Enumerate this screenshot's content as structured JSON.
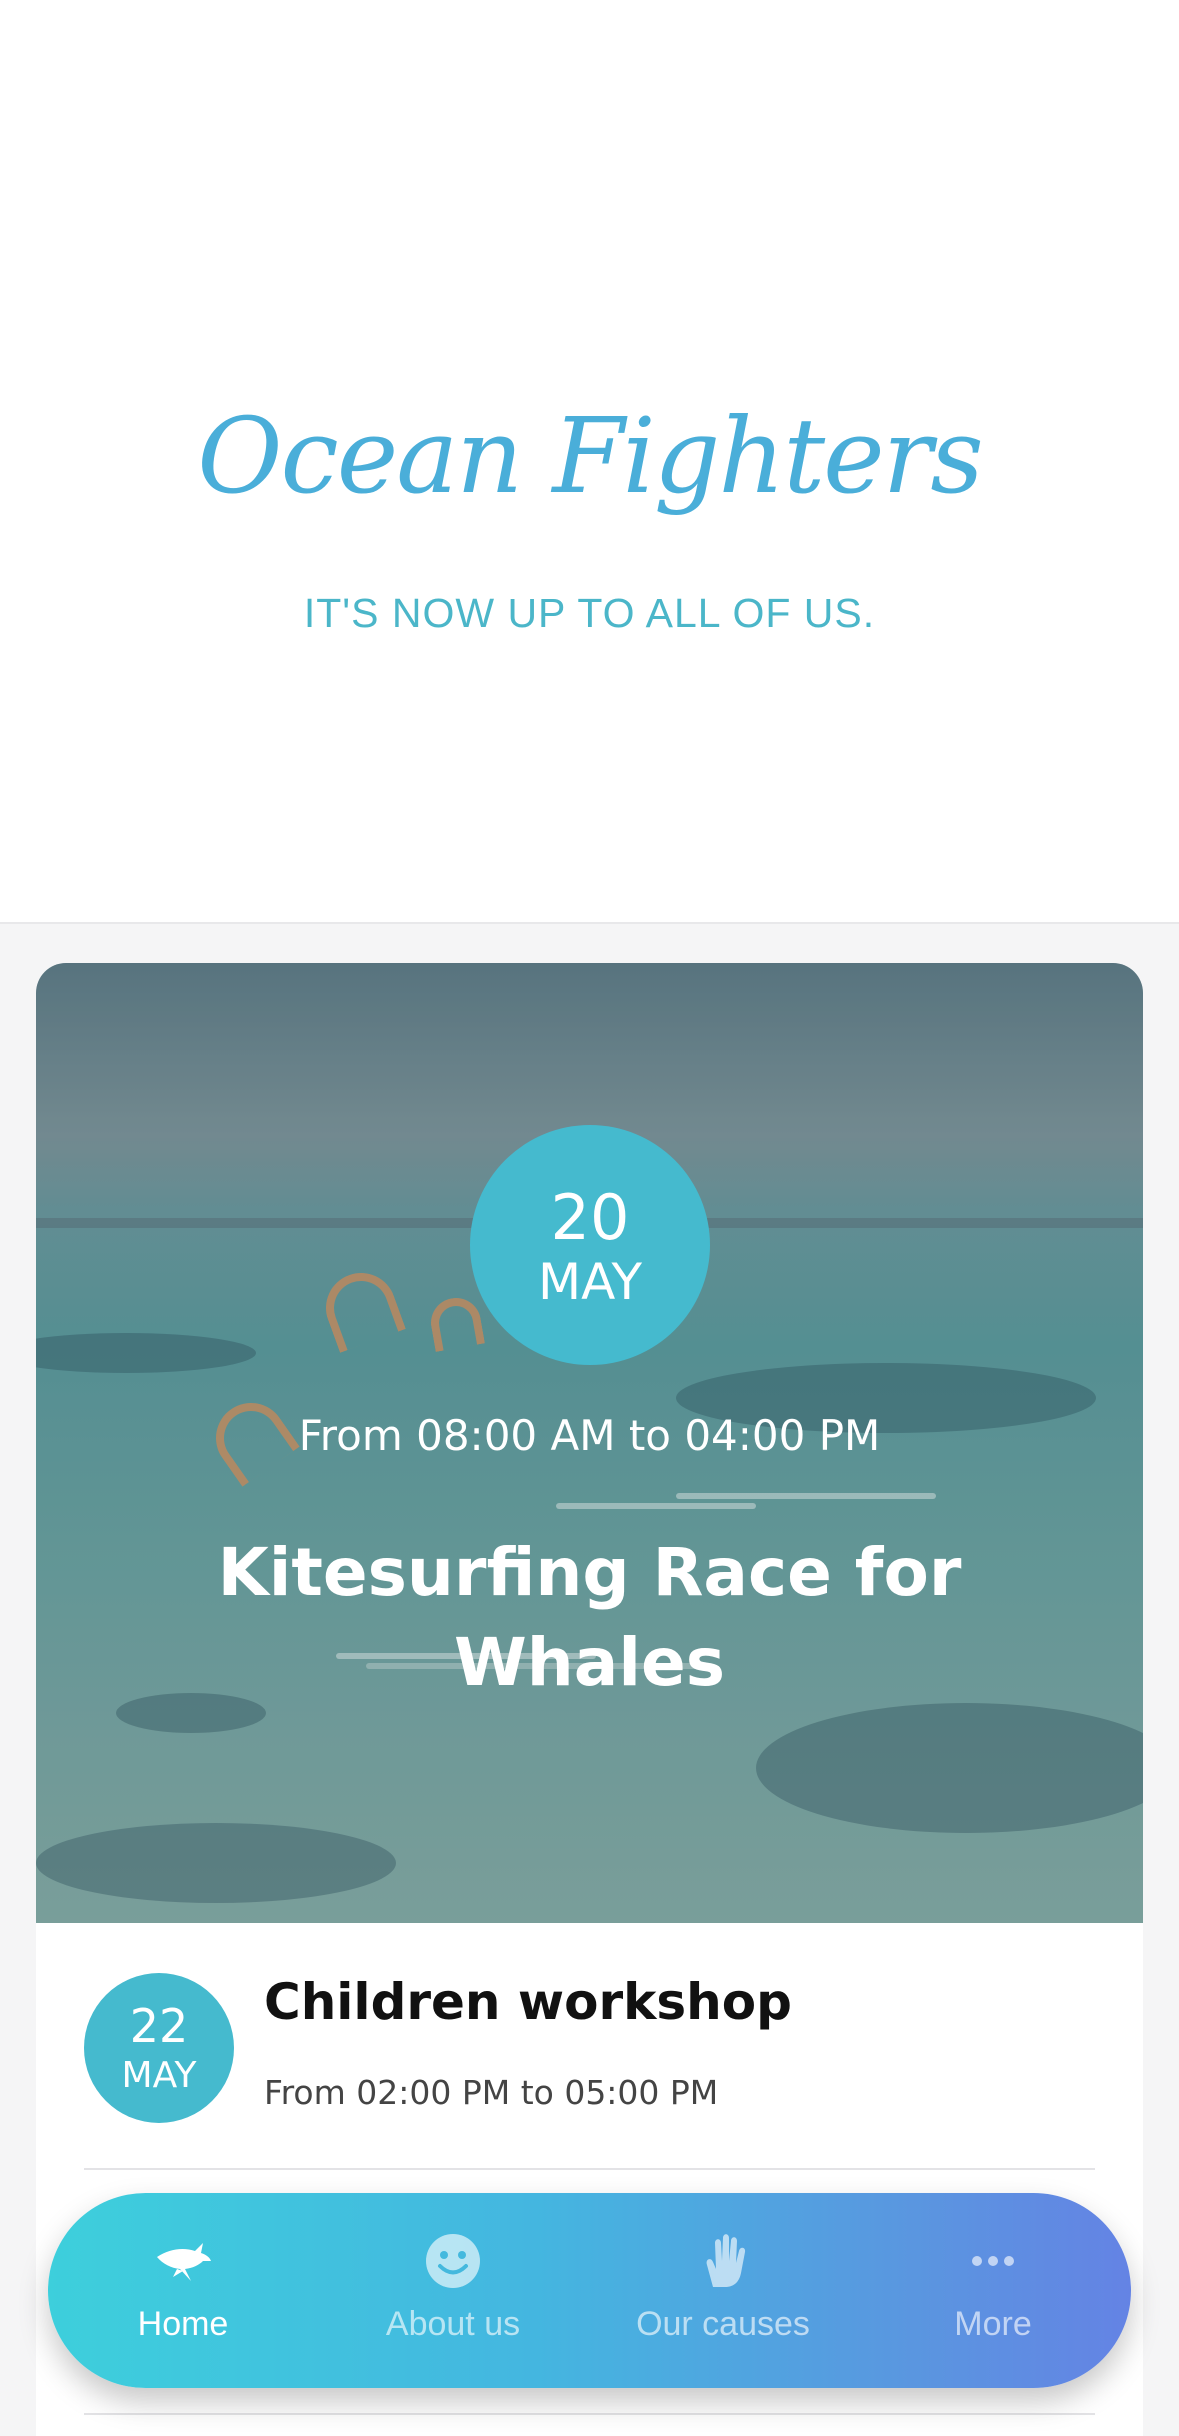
{
  "header": {
    "title": "Ocean Fighters",
    "tagline": "IT'S NOW UP TO ALL OF US."
  },
  "featured_event": {
    "day": "20",
    "month": "MAY",
    "time": "From 08:00 AM to 04:00 PM",
    "title": "Kitesurfing Race for Whales"
  },
  "events": [
    {
      "day": "22",
      "month": "MAY",
      "title": "Children workshop",
      "time": "From 02:00 PM to 05:00 PM"
    }
  ],
  "tabbar": {
    "tabs": [
      {
        "label": "Home",
        "icon": "shark-icon",
        "active": true
      },
      {
        "label": "About us",
        "icon": "smiley-icon",
        "active": false
      },
      {
        "label": "Our causes",
        "icon": "hand-icon",
        "active": false
      },
      {
        "label": "More",
        "icon": "more-dots-icon",
        "active": false
      }
    ]
  },
  "colors": {
    "brand": "#4aaed9",
    "badge": "#45bace",
    "tab_gradient_start": "#3dcfdc",
    "tab_gradient_end": "#6483e4"
  }
}
